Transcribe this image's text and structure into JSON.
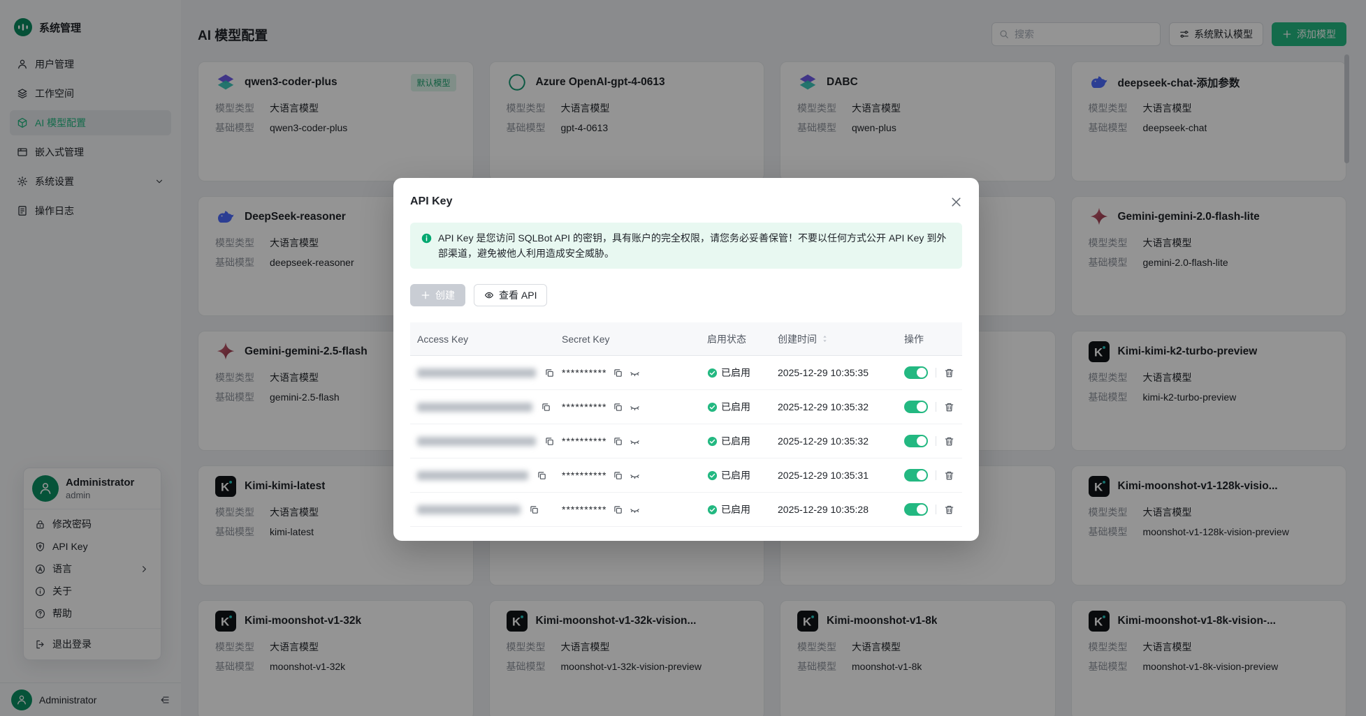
{
  "colors": {
    "primary": "#23b881",
    "success": "#23b881",
    "notice_bg": "#e8f8f1",
    "notice_icon": "#00a870",
    "text": "#1f2329",
    "text_secondary": "#646a73",
    "badge_text": "#1ea26f"
  },
  "sidebar": {
    "app_title": "系统管理",
    "items": [
      {
        "key": "users",
        "label": "用户管理",
        "icon": "user-icon"
      },
      {
        "key": "workspace",
        "label": "工作空间",
        "icon": "workspace-icon"
      },
      {
        "key": "ai-models",
        "label": "AI 模型配置",
        "icon": "model-icon",
        "active": true
      },
      {
        "key": "embedded",
        "label": "嵌入式管理",
        "icon": "embed-icon"
      },
      {
        "key": "settings",
        "label": "系统设置",
        "icon": "settings-icon",
        "chevron": true
      },
      {
        "key": "logs",
        "label": "操作日志",
        "icon": "log-icon"
      }
    ],
    "user_menu": {
      "display_name": "Administrator",
      "username": "admin",
      "items": [
        {
          "key": "change-password",
          "label": "修改密码",
          "icon": "lock-icon"
        },
        {
          "key": "api-key",
          "label": "API Key",
          "icon": "shield-icon"
        },
        {
          "key": "language",
          "label": "语言",
          "icon": "language-icon",
          "chevron": true
        },
        {
          "key": "about",
          "label": "关于",
          "icon": "about-icon"
        },
        {
          "key": "help",
          "label": "帮助",
          "icon": "help-icon"
        }
      ],
      "logout_label": "退出登录"
    },
    "bottom_name": "Administrator"
  },
  "header": {
    "title": "AI 模型配置",
    "search_placeholder": "搜索",
    "default_model_button": "系统默认模型",
    "add_model_button": "添加模型"
  },
  "cards": {
    "type_label": "模型类型",
    "base_label": "基础模型",
    "default_badge": "默认模型",
    "items": [
      {
        "name": "qwen3-coder-plus",
        "logo": "qwen",
        "type": "大语言模型",
        "base": "qwen3-coder-plus",
        "badge": true
      },
      {
        "name": "Azure OpenAI-gpt-4-0613",
        "logo": "openai",
        "type": "大语言模型",
        "base": "gpt-4-0613"
      },
      {
        "name": "DABC",
        "logo": "qwen",
        "type": "大语言模型",
        "base": "qwen-plus"
      },
      {
        "name": "deepseek-chat-添加参数",
        "logo": "deepseek",
        "type": "大语言模型",
        "base": "deepseek-chat"
      },
      {
        "name": "DeepSeek-reasoner",
        "logo": "deepseek",
        "type": "大语言模型",
        "base": "deepseek-reasoner"
      },
      {
        "covered": true
      },
      {
        "covered": true
      },
      {
        "name": "Gemini-gemini-2.0-flash-lite",
        "logo": "gemini",
        "type": "大语言模型",
        "base": "gemini-2.0-flash-lite"
      },
      {
        "name": "Gemini-gemini-2.5-flash",
        "logo": "gemini",
        "type": "大语言模型",
        "base": "gemini-2.5-flash"
      },
      {
        "covered": true
      },
      {
        "covered": true
      },
      {
        "name": "Kimi-kimi-k2-turbo-preview",
        "logo": "kimi",
        "type": "大语言模型",
        "base": "kimi-k2-turbo-preview"
      },
      {
        "name": "Kimi-kimi-latest",
        "logo": "kimi",
        "type": "大语言模型",
        "base": "kimi-latest"
      },
      {
        "covered": true
      },
      {
        "covered": true
      },
      {
        "name": "Kimi-moonshot-v1-128k-visio...",
        "logo": "kimi",
        "type": "大语言模型",
        "base": "moonshot-v1-128k-vision-preview"
      },
      {
        "name": "Kimi-moonshot-v1-32k",
        "logo": "kimi",
        "type": "大语言模型",
        "base": "moonshot-v1-32k"
      },
      {
        "name": "Kimi-moonshot-v1-32k-vision...",
        "logo": "kimi",
        "type": "大语言模型",
        "base": "moonshot-v1-32k-vision-preview"
      },
      {
        "name": "Kimi-moonshot-v1-8k",
        "logo": "kimi",
        "type": "大语言模型",
        "base": "moonshot-v1-8k"
      },
      {
        "name": "Kimi-moonshot-v1-8k-vision-...",
        "logo": "kimi",
        "type": "大语言模型",
        "base": "moonshot-v1-8k-vision-preview"
      }
    ]
  },
  "modal": {
    "title": "API Key",
    "notice": "API Key 是您访问 SQLBot API 的密钥，具有账户的完全权限，请您务必妥善保管！不要以任何方式公开 API Key 到外部渠道，避免被他人利用造成安全威胁。",
    "create_button": "创建",
    "view_api_button": "查看 API",
    "table": {
      "columns": [
        "Access Key",
        "Secret Key",
        "启用状态",
        "创建时间",
        "操作"
      ],
      "secret_mask": "**********",
      "status_enabled": "已启用",
      "rows": [
        {
          "created": "2025-12-29 10:35:35",
          "enabled": true
        },
        {
          "created": "2025-12-29 10:35:32",
          "enabled": true
        },
        {
          "created": "2025-12-29 10:35:32",
          "enabled": true
        },
        {
          "created": "2025-12-29 10:35:31",
          "enabled": true
        },
        {
          "created": "2025-12-29 10:35:28",
          "enabled": true
        }
      ]
    }
  }
}
